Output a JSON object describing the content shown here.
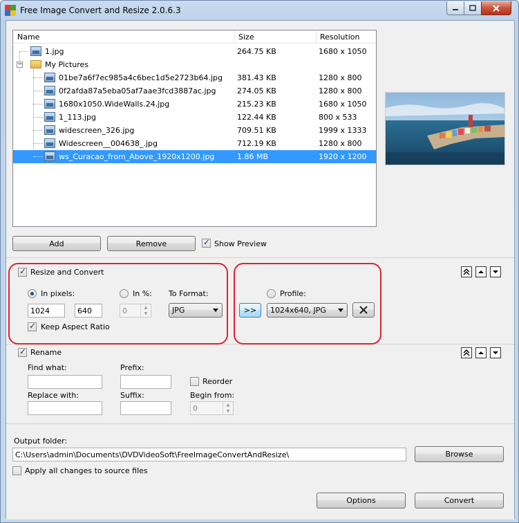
{
  "window": {
    "title": "Free Image Convert and Resize 2.0.6.3"
  },
  "filelist": {
    "columns": {
      "name": "Name",
      "size": "Size",
      "resolution": "Resolution"
    },
    "rows": [
      {
        "name": "1.jpg",
        "size": "264.75 KB",
        "resolution": "1680 x 1050",
        "type": "file"
      },
      {
        "name": "My Pictures",
        "size": "",
        "resolution": "",
        "type": "folder"
      },
      {
        "name": "01be7a6f7ec985a4c6bec1d5e2723b64.jpg",
        "size": "381.43 KB",
        "resolution": "1280 x 800",
        "type": "file"
      },
      {
        "name": "0f2afda87a5eba05af7aae3fcd3887ac.jpg",
        "size": "274.05 KB",
        "resolution": "1280 x 800",
        "type": "file"
      },
      {
        "name": "1680x1050.WideWalls.24.jpg",
        "size": "215.23 KB",
        "resolution": "1680 x 1050",
        "type": "file"
      },
      {
        "name": "1_113.jpg",
        "size": "122.44 KB",
        "resolution": "800 x 533",
        "type": "file"
      },
      {
        "name": "widescreen_326.jpg",
        "size": "709.51 KB",
        "resolution": "1999 x 1333",
        "type": "file"
      },
      {
        "name": "Widescreen__004638_.jpg",
        "size": "712.19 KB",
        "resolution": "1280 x 800",
        "type": "file"
      },
      {
        "name": "ws_Curacao_from_Above_1920x1200.jpg",
        "size": "1.86 MB",
        "resolution": "1920 x 1200",
        "type": "file",
        "selected": true
      }
    ]
  },
  "actions": {
    "add": "Add",
    "remove": "Remove",
    "show_preview": "Show Preview",
    "show_preview_checked": true
  },
  "resize": {
    "title": "Resize and Convert",
    "enabled": true,
    "in_pixels_label": "In pixels:",
    "in_pixels_selected": true,
    "width": "1024",
    "height": "640",
    "in_percent_label": "In %:",
    "percent_value": "0",
    "to_format_label": "To Format:",
    "format_value": "JPG",
    "keep_aspect_label": "Keep Aspect Ratio",
    "keep_aspect_checked": true,
    "apply_profile_btn": ">>",
    "profile_label": "Profile:",
    "profile_selected": false,
    "profile_value": "1024x640, JPG"
  },
  "rename": {
    "title": "Rename",
    "enabled": true,
    "find_label": "Find what:",
    "find_value": "",
    "prefix_label": "Prefix:",
    "prefix_value": "",
    "reorder_label": "Reorder",
    "reorder_checked": false,
    "replace_label": "Replace with:",
    "replace_value": "",
    "suffix_label": "Suffix:",
    "suffix_value": "",
    "begin_label": "Begin from:",
    "begin_value": "0"
  },
  "output": {
    "folder_label": "Output folder:",
    "folder_value": "C:\\Users\\admin\\Documents\\DVDVideoSoft\\FreeImageConvertAndResize\\",
    "browse": "Browse",
    "apply_source_label": "Apply all changes to source files",
    "apply_source_checked": false
  },
  "footer": {
    "options": "Options",
    "convert": "Convert"
  },
  "colors": {
    "selection": "#3399ff",
    "highlight_border": "#e0242b"
  }
}
